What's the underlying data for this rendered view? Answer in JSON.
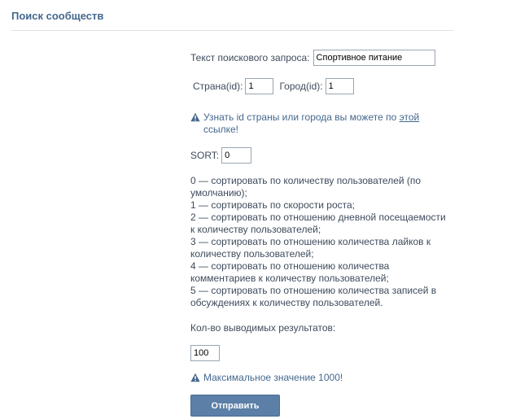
{
  "header": {
    "title": "Поиск сообществ"
  },
  "form": {
    "query_label": "Текст поискового запроса:",
    "query_value": "Спортивное питание",
    "country_label": "Страна(id):",
    "country_value": "1",
    "city_label": "Город(id):",
    "city_value": "1",
    "id_hint_prefix": "Узнать id страны или города вы можете по ",
    "id_hint_link": "этой",
    "id_hint_suffix": "ссылке!",
    "sort_label": "SORT:",
    "sort_value": "0",
    "sort_help": [
      "0 — сортировать по количеству пользователей (по умолчанию);",
      "1 — сортировать по скорости роста;",
      "2 — сортировать по отношению дневной посещаемости к количеству пользователей;",
      "3 — сортировать по отношению количества лайков к количеству пользователей;",
      "4 — сортировать по отношению количества комментариев к количеству пользователей;",
      "5 — сортировать по отношению количества записей в обсуждениях к количеству пользователей."
    ],
    "results_label": "Кол-во выводимых результатов:",
    "results_value": "100",
    "max_hint": "Максимальное значение 1000!",
    "submit_label": "Отправить"
  },
  "icons": {
    "warning": "warning-triangle-icon"
  },
  "colors": {
    "accent": "#45688e",
    "button": "#5b7fa6",
    "text": "#3e4b5c"
  }
}
